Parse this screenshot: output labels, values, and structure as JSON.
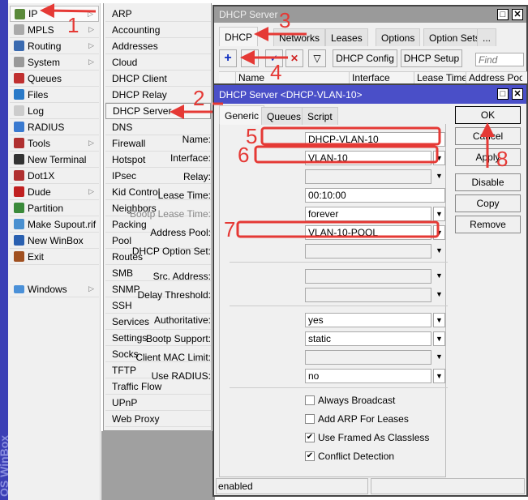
{
  "brand": "OS WinBox",
  "main_menu": [
    {
      "label": "IP",
      "icon": "ip-icon",
      "color": "#5a8a3a",
      "submenu": true
    },
    {
      "label": "MPLS",
      "icon": "mpls-icon",
      "color": "#aaaaaa",
      "submenu": true
    },
    {
      "label": "Routing",
      "icon": "routing-icon",
      "color": "#3a6ab0",
      "submenu": true
    },
    {
      "label": "System",
      "icon": "system-gear-icon",
      "color": "#999999",
      "submenu": true
    },
    {
      "label": "Queues",
      "icon": "queues-icon",
      "color": "#c03030",
      "submenu": false
    },
    {
      "label": "Files",
      "icon": "folder-icon",
      "color": "#2a7ac8",
      "submenu": false
    },
    {
      "label": "Log",
      "icon": "log-icon",
      "color": "#cccccc",
      "submenu": false
    },
    {
      "label": "RADIUS",
      "icon": "radius-icon",
      "color": "#3a7ad0",
      "submenu": false
    },
    {
      "label": "Tools",
      "icon": "tools-icon",
      "color": "#b03030",
      "submenu": true
    },
    {
      "label": "New Terminal",
      "icon": "terminal-icon",
      "color": "#333333",
      "submenu": false
    },
    {
      "label": "Dot1X",
      "icon": "dot1x-icon",
      "color": "#b03030",
      "submenu": false
    },
    {
      "label": "Dude",
      "icon": "dude-icon",
      "color": "#c02020",
      "submenu": true
    },
    {
      "label": "Partition",
      "icon": "partition-icon",
      "color": "#3a8a3a",
      "submenu": false
    },
    {
      "label": "Make Supout.rif",
      "icon": "supout-icon",
      "color": "#4a90d0",
      "submenu": false
    },
    {
      "label": "New WinBox",
      "icon": "winbox-icon",
      "color": "#2a60b0",
      "submenu": false
    },
    {
      "label": "Exit",
      "icon": "exit-icon",
      "color": "#a05020",
      "submenu": false
    }
  ],
  "windows_item": {
    "label": "Windows",
    "icon": "windows-icon",
    "color": "#4a90d8"
  },
  "ip_submenu": [
    "ARP",
    "Accounting",
    "Addresses",
    "Cloud",
    "DHCP Client",
    "DHCP Relay",
    "DHCP Server",
    "DNS",
    "Firewall",
    "Hotspot",
    "IPsec",
    "Kid Control",
    "Neighbors",
    "Packing",
    "Pool",
    "Routes",
    "SMB",
    "SNMP",
    "SSH",
    "Services",
    "Settings",
    "Socks",
    "TFTP",
    "Traffic Flow",
    "UPnP",
    "Web Proxy"
  ],
  "dhcp_window": {
    "title": "DHCP Server",
    "tabs": [
      "DHCP",
      "Networks",
      "Leases",
      "Options",
      "Option Sets",
      "..."
    ],
    "toolbar": {
      "dhcp_config": "DHCP Config",
      "dhcp_setup": "DHCP Setup",
      "find_placeholder": "Find"
    },
    "columns": [
      "Name",
      "Interface",
      "Lease Time",
      "Address Poo"
    ]
  },
  "dialog": {
    "title": "DHCP Server <DHCP-VLAN-10>",
    "tabs": [
      "Generic",
      "Queues",
      "Script"
    ],
    "fields": {
      "name": {
        "label": "Name:",
        "value": "DHCP-VLAN-10"
      },
      "interface": {
        "label": "Interface:",
        "value": "VLAN-10"
      },
      "relay": {
        "label": "Relay:",
        "value": ""
      },
      "lease_time": {
        "label": "Lease Time:",
        "value": "00:10:00"
      },
      "bootp_lease_time": {
        "label": "Bootp Lease Time:",
        "value": "forever"
      },
      "address_pool": {
        "label": "Address Pool:",
        "value": "VLAN-10-POOL"
      },
      "dhcp_option_set": {
        "label": "DHCP Option Set:",
        "value": ""
      },
      "src_address": {
        "label": "Src. Address:",
        "value": ""
      },
      "delay_threshold": {
        "label": "Delay Threshold:",
        "value": ""
      },
      "authoritative": {
        "label": "Authoritative:",
        "value": "yes"
      },
      "bootp_support": {
        "label": "Bootp Support:",
        "value": "static"
      },
      "client_mac_limit": {
        "label": "Client MAC Limit:",
        "value": ""
      },
      "use_radius": {
        "label": "Use RADIUS:",
        "value": "no"
      }
    },
    "checkboxes": [
      {
        "label": "Always Broadcast",
        "checked": false
      },
      {
        "label": "Add ARP For Leases",
        "checked": false
      },
      {
        "label": "Use Framed As Classless",
        "checked": true
      },
      {
        "label": "Conflict Detection",
        "checked": true
      }
    ],
    "buttons": {
      "ok": "OK",
      "cancel": "Cancel",
      "apply": "Apply",
      "disable": "Disable",
      "copy": "Copy",
      "remove": "Remove"
    },
    "status": "enabled"
  },
  "annotations": {
    "color": "#e53935",
    "steps": [
      "1",
      "2",
      "3",
      "4",
      "5",
      "6",
      "7",
      "8"
    ]
  }
}
